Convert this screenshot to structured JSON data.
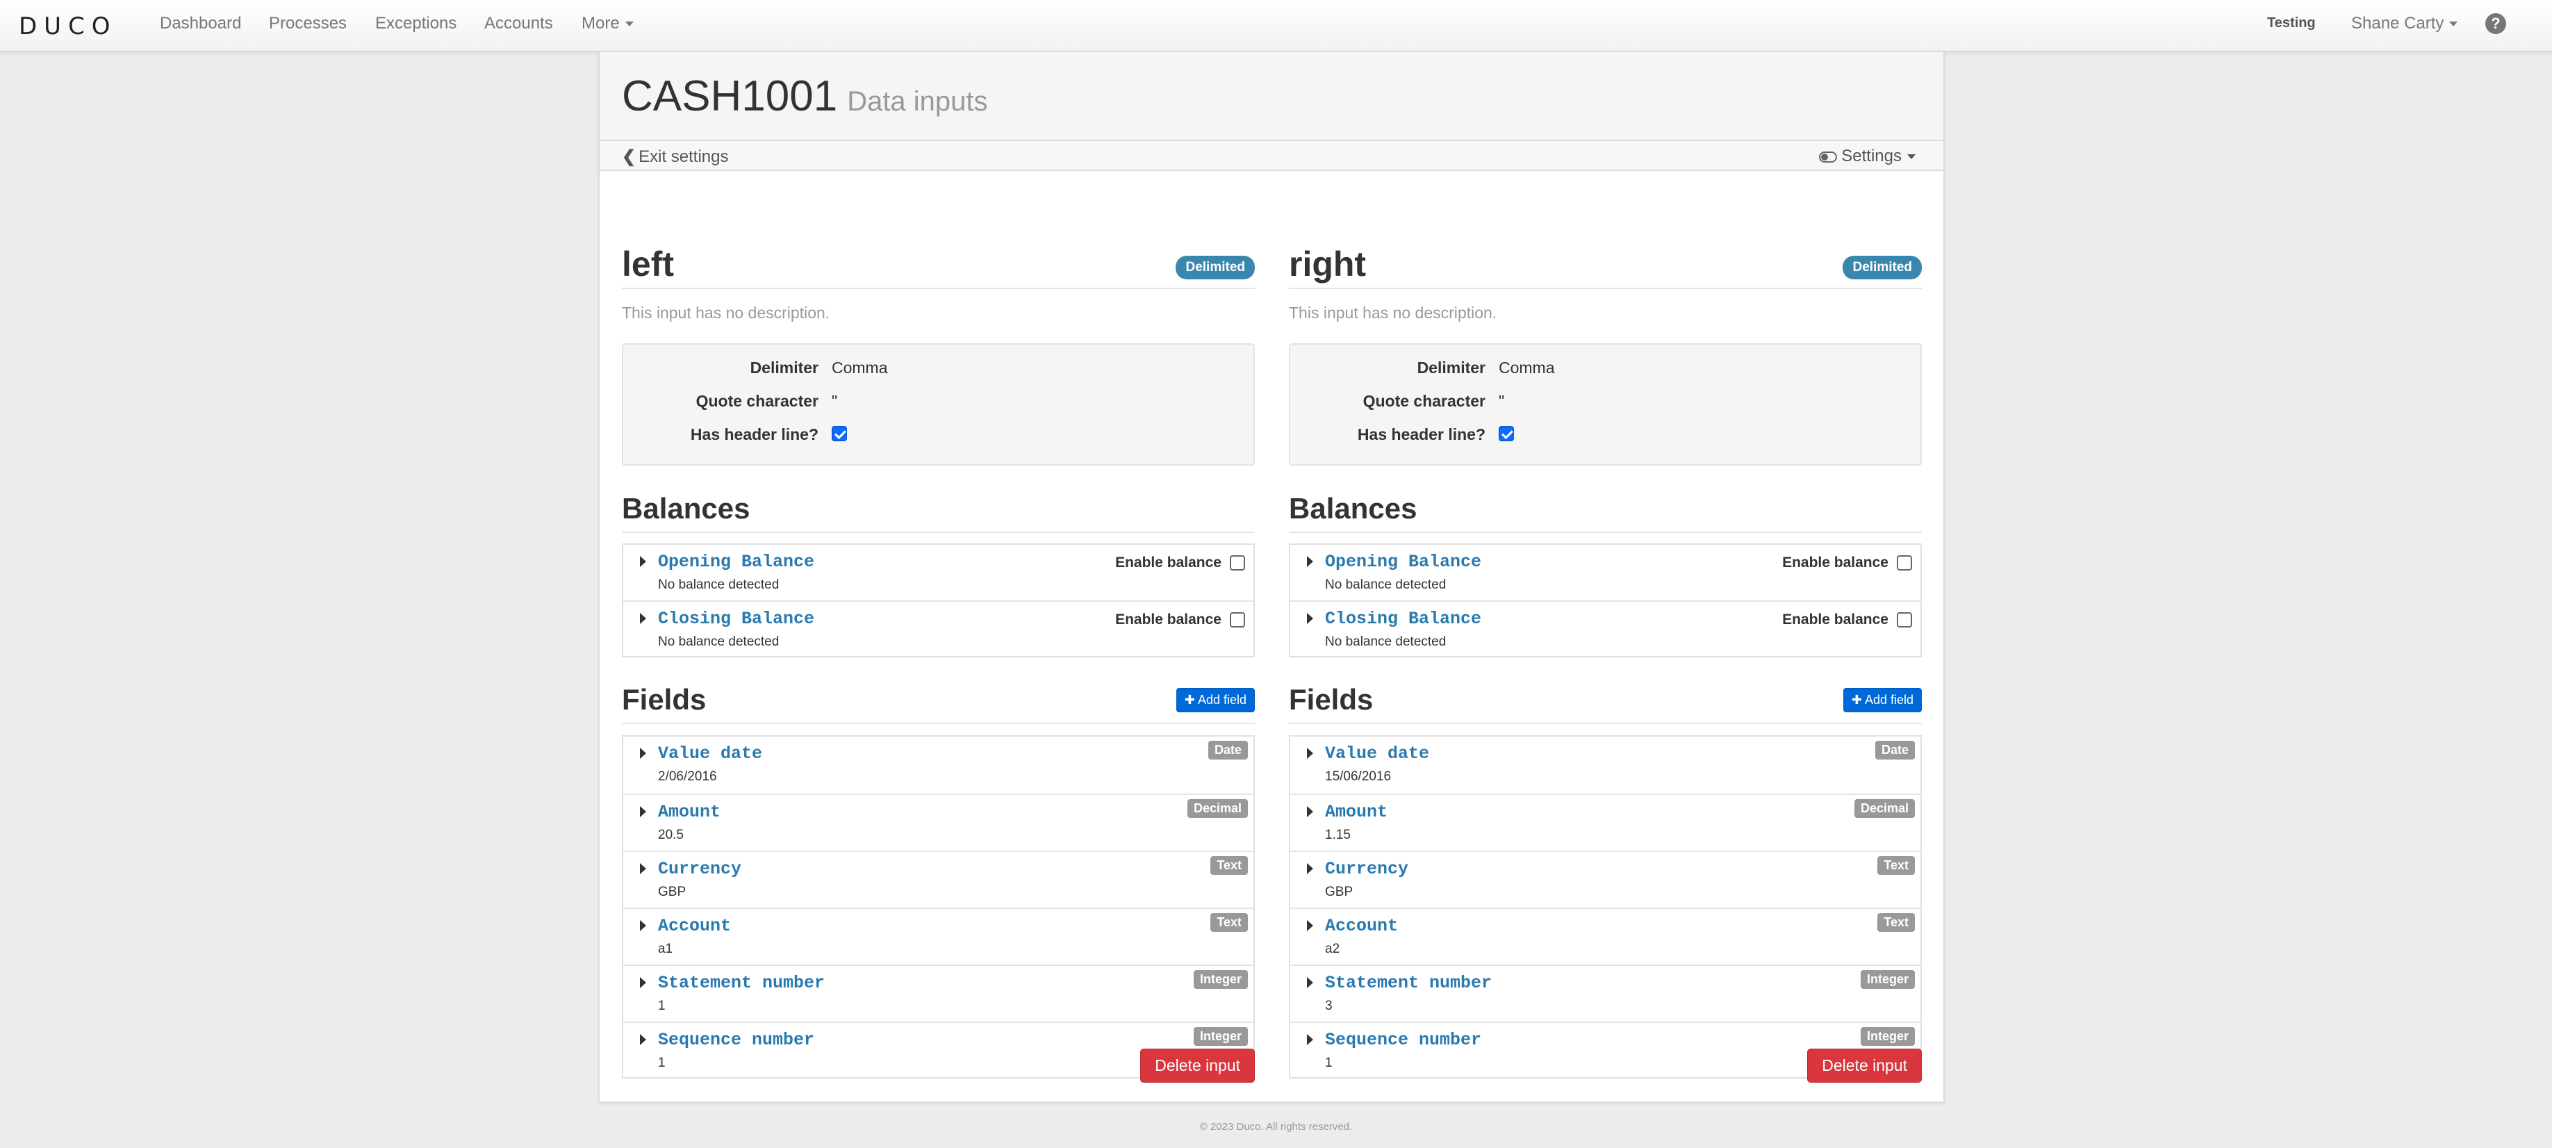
{
  "nav": {
    "brand": "DUCO",
    "links": [
      "Dashboard",
      "Processes",
      "Exceptions",
      "Accounts"
    ],
    "more": "More",
    "environment": "Testing",
    "user": "Shane Carty",
    "help": "?"
  },
  "page": {
    "title": "CASH1001",
    "subtitle": "Data inputs",
    "exit": "Exit settings",
    "settings": "Settings"
  },
  "labels": {
    "delimiter": "Delimiter",
    "quote": "Quote character",
    "header": "Has header line?",
    "balances": "Balances",
    "enable_balance": "Enable balance",
    "fields": "Fields",
    "add_field": "Add field",
    "delete": "Delete input"
  },
  "inputs": [
    {
      "name": "left",
      "format": "Delimited",
      "description": "This input has no description.",
      "delimiter": "Comma",
      "quote": "\"",
      "has_header": true,
      "balances": [
        {
          "name": "Opening Balance",
          "status": "No balance detected",
          "enabled": false
        },
        {
          "name": "Closing Balance",
          "status": "No balance detected",
          "enabled": false
        }
      ],
      "fields": [
        {
          "name": "Value date",
          "value": "2/06/2016",
          "type": "Date"
        },
        {
          "name": "Amount",
          "value": "20.5",
          "type": "Decimal"
        },
        {
          "name": "Currency",
          "value": "GBP",
          "type": "Text"
        },
        {
          "name": "Account",
          "value": "a1",
          "type": "Text"
        },
        {
          "name": "Statement number",
          "value": "1",
          "type": "Integer"
        },
        {
          "name": "Sequence number",
          "value": "1",
          "type": "Integer"
        }
      ]
    },
    {
      "name": "right",
      "format": "Delimited",
      "description": "This input has no description.",
      "delimiter": "Comma",
      "quote": "\"",
      "has_header": true,
      "balances": [
        {
          "name": "Opening Balance",
          "status": "No balance detected",
          "enabled": false
        },
        {
          "name": "Closing Balance",
          "status": "No balance detected",
          "enabled": false
        }
      ],
      "fields": [
        {
          "name": "Value date",
          "value": "15/06/2016",
          "type": "Date"
        },
        {
          "name": "Amount",
          "value": "1.15",
          "type": "Decimal"
        },
        {
          "name": "Currency",
          "value": "GBP",
          "type": "Text"
        },
        {
          "name": "Account",
          "value": "a2",
          "type": "Text"
        },
        {
          "name": "Statement number",
          "value": "3",
          "type": "Integer"
        },
        {
          "name": "Sequence number",
          "value": "1",
          "type": "Integer"
        }
      ]
    }
  ],
  "footer": "© 2023 Duco. All rights reserved.",
  "colors": {
    "badge_blue": "#3a87ad",
    "link": "#2a7ab0",
    "primary": "#0069d9",
    "danger": "#d9363e"
  }
}
